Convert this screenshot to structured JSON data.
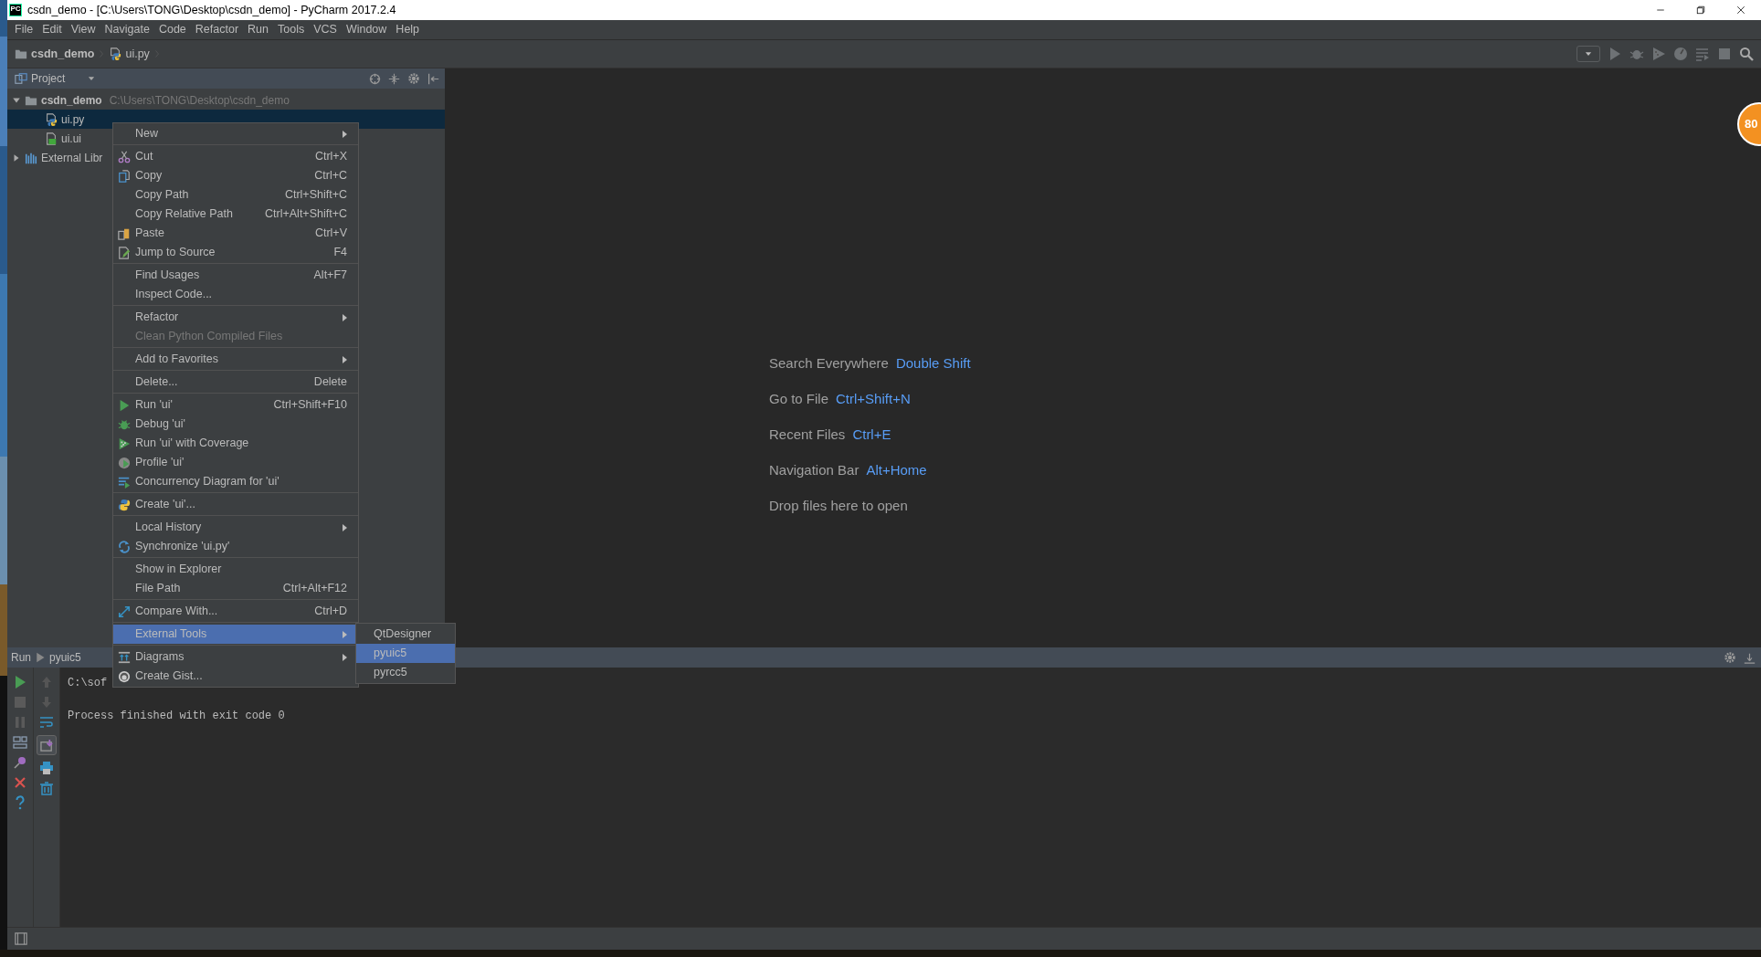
{
  "window": {
    "logo": "PC",
    "title": "csdn_demo - [C:\\Users\\TONG\\Desktop\\csdn_demo] - PyCharm 2017.2.4"
  },
  "menu_bar": [
    {
      "label": "File"
    },
    {
      "label": "Edit"
    },
    {
      "label": "View"
    },
    {
      "label": "Navigate"
    },
    {
      "label": "Code"
    },
    {
      "label": "Refactor"
    },
    {
      "label": "Run"
    },
    {
      "label": "Tools"
    },
    {
      "label": "VCS"
    },
    {
      "label": "Window"
    },
    {
      "label": "Help"
    }
  ],
  "breadcrumbs": [
    {
      "label": "csdn_demo",
      "kind": "folder"
    },
    {
      "label": "ui.py",
      "kind": "python"
    }
  ],
  "project_panel": {
    "title": "Project",
    "tree": [
      {
        "label": "csdn_demo",
        "kind": "folder",
        "path": "C:\\Users\\TONG\\Desktop\\csdn_demo",
        "expanded": true,
        "selected": false,
        "children": [
          {
            "label": "ui.py",
            "kind": "python",
            "selected": true
          },
          {
            "label": "ui.ui",
            "kind": "qt",
            "selected": false
          }
        ]
      },
      {
        "label": "External Libr",
        "kind": "library",
        "expanded": false,
        "selected": false
      }
    ]
  },
  "context_menu": {
    "groups": [
      [
        {
          "label": "New",
          "submenu": true,
          "disabled": false,
          "selected": false
        }
      ],
      [
        {
          "label": "Cut",
          "shortcut": "Ctrl+X",
          "submenu": false,
          "disabled": false,
          "selected": false
        },
        {
          "label": "Copy",
          "shortcut": "Ctrl+C",
          "submenu": false,
          "disabled": false,
          "selected": false
        },
        {
          "label": "Copy Path",
          "shortcut": "Ctrl+Shift+C",
          "submenu": false,
          "disabled": false,
          "selected": false
        },
        {
          "label": "Copy Relative Path",
          "shortcut": "Ctrl+Alt+Shift+C",
          "submenu": false,
          "disabled": false,
          "selected": false
        },
        {
          "label": "Paste",
          "shortcut": "Ctrl+V",
          "submenu": false,
          "disabled": false,
          "selected": false
        },
        {
          "label": "Jump to Source",
          "shortcut": "F4",
          "submenu": false,
          "disabled": false,
          "selected": false
        }
      ],
      [
        {
          "label": "Find Usages",
          "shortcut": "Alt+F7",
          "submenu": false,
          "disabled": false,
          "selected": false
        },
        {
          "label": "Inspect Code...",
          "submenu": false,
          "disabled": false,
          "selected": false
        }
      ],
      [
        {
          "label": "Refactor",
          "submenu": true,
          "disabled": false,
          "selected": false
        },
        {
          "label": "Clean Python Compiled Files",
          "submenu": false,
          "disabled": true,
          "selected": false
        }
      ],
      [
        {
          "label": "Add to Favorites",
          "submenu": true,
          "disabled": false,
          "selected": false
        }
      ],
      [
        {
          "label": "Delete...",
          "shortcut": "Delete",
          "submenu": false,
          "disabled": false,
          "selected": false
        }
      ],
      [
        {
          "label": "Run 'ui'",
          "shortcut": "Ctrl+Shift+F10",
          "submenu": false,
          "disabled": false,
          "selected": false
        },
        {
          "label": "Debug 'ui'",
          "submenu": false,
          "disabled": false,
          "selected": false
        },
        {
          "label": "Run 'ui' with Coverage",
          "submenu": false,
          "disabled": false,
          "selected": false
        },
        {
          "label": "Profile 'ui'",
          "submenu": false,
          "disabled": false,
          "selected": false
        },
        {
          "label": "Concurrency Diagram for  'ui'",
          "submenu": false,
          "disabled": false,
          "selected": false
        }
      ],
      [
        {
          "label": "Create 'ui'...",
          "submenu": false,
          "disabled": false,
          "selected": false
        }
      ],
      [
        {
          "label": "Local History",
          "submenu": true,
          "disabled": false,
          "selected": false
        },
        {
          "label": "Synchronize 'ui.py'",
          "submenu": false,
          "disabled": false,
          "selected": false
        }
      ],
      [
        {
          "label": "Show in Explorer",
          "submenu": false,
          "disabled": false,
          "selected": false
        },
        {
          "label": "File Path",
          "shortcut": "Ctrl+Alt+F12",
          "submenu": false,
          "disabled": false,
          "selected": false
        }
      ],
      [
        {
          "label": "Compare With...",
          "shortcut": "Ctrl+D",
          "submenu": false,
          "disabled": false,
          "selected": false
        }
      ],
      [
        {
          "label": "External Tools",
          "submenu": true,
          "disabled": false,
          "selected": true
        }
      ],
      [
        {
          "label": "Diagrams",
          "submenu": true,
          "disabled": false,
          "selected": false
        },
        {
          "label": "Create Gist...",
          "submenu": false,
          "disabled": false,
          "selected": false
        }
      ]
    ]
  },
  "submenu": {
    "items": [
      {
        "label": "QtDesigner",
        "selected": false
      },
      {
        "label": "pyuic5",
        "selected": true
      },
      {
        "label": "pyrcc5",
        "selected": false
      }
    ]
  },
  "editor_hints": [
    {
      "label": "Search Everywhere",
      "shortcut": "Double Shift"
    },
    {
      "label": "Go to File",
      "shortcut": "Ctrl+Shift+N"
    },
    {
      "label": "Recent Files",
      "shortcut": "Ctrl+E"
    },
    {
      "label": "Navigation Bar",
      "shortcut": "Alt+Home"
    },
    {
      "label": "Drop files here to open"
    }
  ],
  "run_panel": {
    "title": "Run",
    "config": "pyuic5",
    "console": [
      "C:\\sof",
      "Process finished with exit code 0"
    ]
  },
  "badge": "80"
}
